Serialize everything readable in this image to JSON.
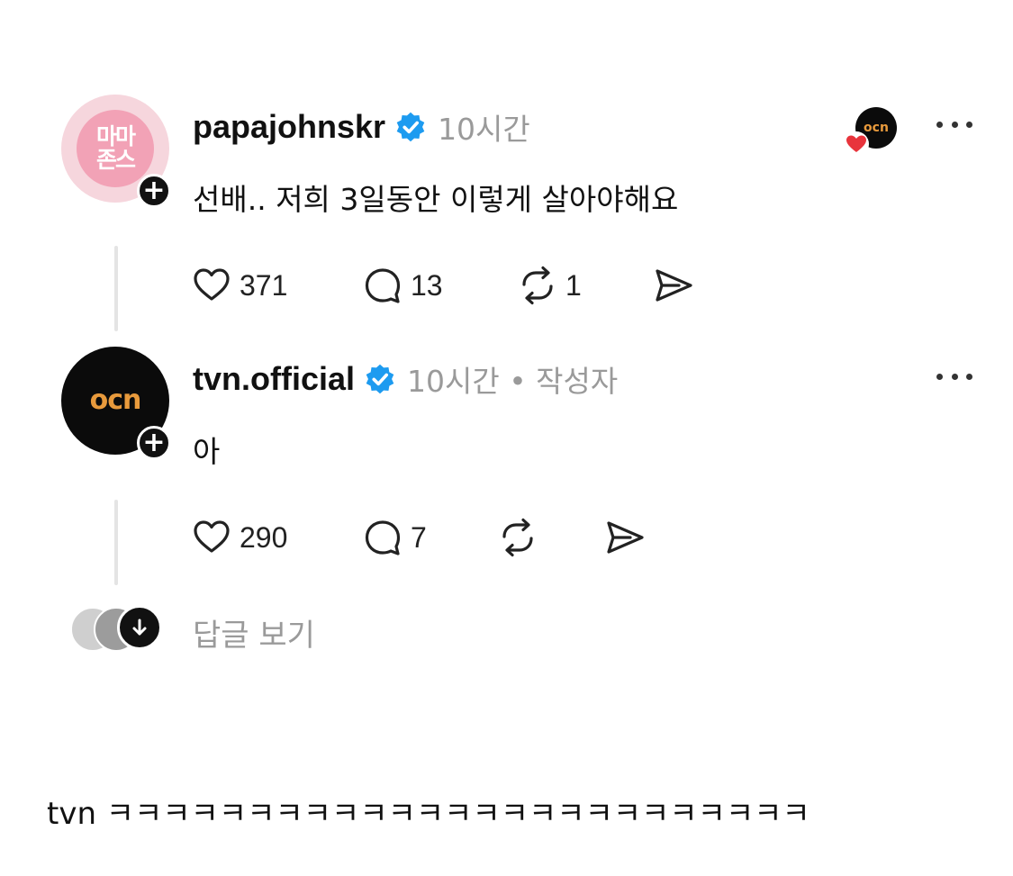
{
  "posts": [
    {
      "username": "papajohnskr",
      "time": "10시간",
      "author_tag": "",
      "text": "선배.. 저희 3일동안 이렇게 살아야해요",
      "avatar_text": [
        "마마",
        "존스"
      ],
      "likes": "371",
      "comments": "13",
      "reposts": "1",
      "liked_by_avatar_text": "ocn"
    },
    {
      "username": "tvn.official",
      "time": "10시간 • 작성자",
      "text": "아",
      "avatar_text": "ocn",
      "likes": "290",
      "comments": "7"
    }
  ],
  "replies": {
    "label": "답글 보기"
  },
  "caption": "tvn ㅋㅋㅋㅋㅋㅋㅋㅋㅋㅋㅋㅋㅋㅋㅋㅋㅋㅋㅋㅋㅋㅋㅋㅋㅋ",
  "colors": {
    "verified": "#1d9bf0",
    "heart": "#e8343c",
    "ocn_logo": "#e89a3c",
    "pink_avatar": "#f2a2b6"
  },
  "icons": [
    "verified-badge-icon",
    "heart-icon",
    "comment-icon",
    "repost-icon",
    "share-icon",
    "more-icon",
    "plus-icon",
    "arrow-down-icon"
  ]
}
